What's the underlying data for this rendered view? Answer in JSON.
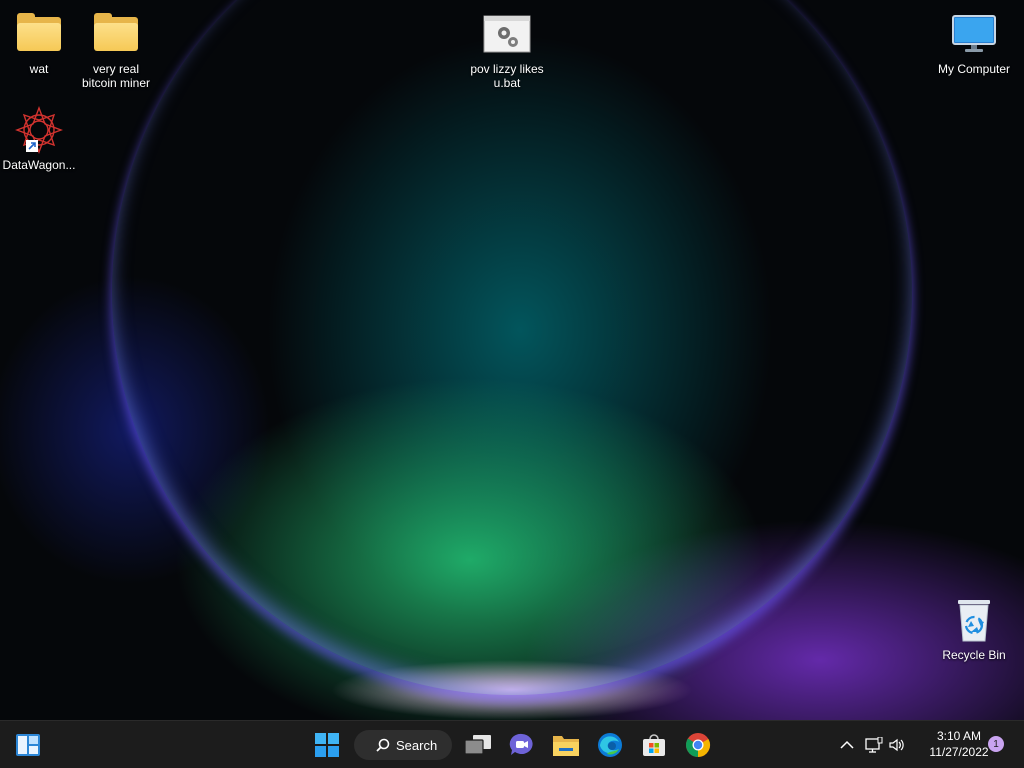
{
  "desktop": {
    "icons": [
      {
        "label": "wat",
        "icon": "folder-icon"
      },
      {
        "label": "very real bitcoin miner",
        "icon": "folder-icon"
      },
      {
        "label": "pov lizzy likes u.bat",
        "icon": "batch-file-icon"
      },
      {
        "label": "My Computer",
        "icon": "monitor-icon"
      },
      {
        "label": "DataWagon...",
        "icon": "shortcut-icon"
      },
      {
        "label": "Recycle Bin",
        "icon": "recycle-bin-icon"
      }
    ]
  },
  "taskbar": {
    "widgets_icon": "widgets-icon",
    "start_icon": "windows-start-icon",
    "search_label": "Search",
    "apps": [
      {
        "name": "Task View",
        "icon": "task-view-icon"
      },
      {
        "name": "Chat",
        "icon": "chat-icon"
      },
      {
        "name": "File Explorer",
        "icon": "file-explorer-icon"
      },
      {
        "name": "Microsoft Edge",
        "icon": "edge-icon"
      },
      {
        "name": "Microsoft Store",
        "icon": "store-icon"
      },
      {
        "name": "Google Chrome",
        "icon": "chrome-icon"
      }
    ],
    "tray": {
      "time": "3:10 AM",
      "date": "11/27/2022",
      "notification_count": "1"
    }
  },
  "colors": {
    "taskbar_bg": "#1c1c1c",
    "accent": "#0078d4",
    "folder": "#f6c956"
  }
}
